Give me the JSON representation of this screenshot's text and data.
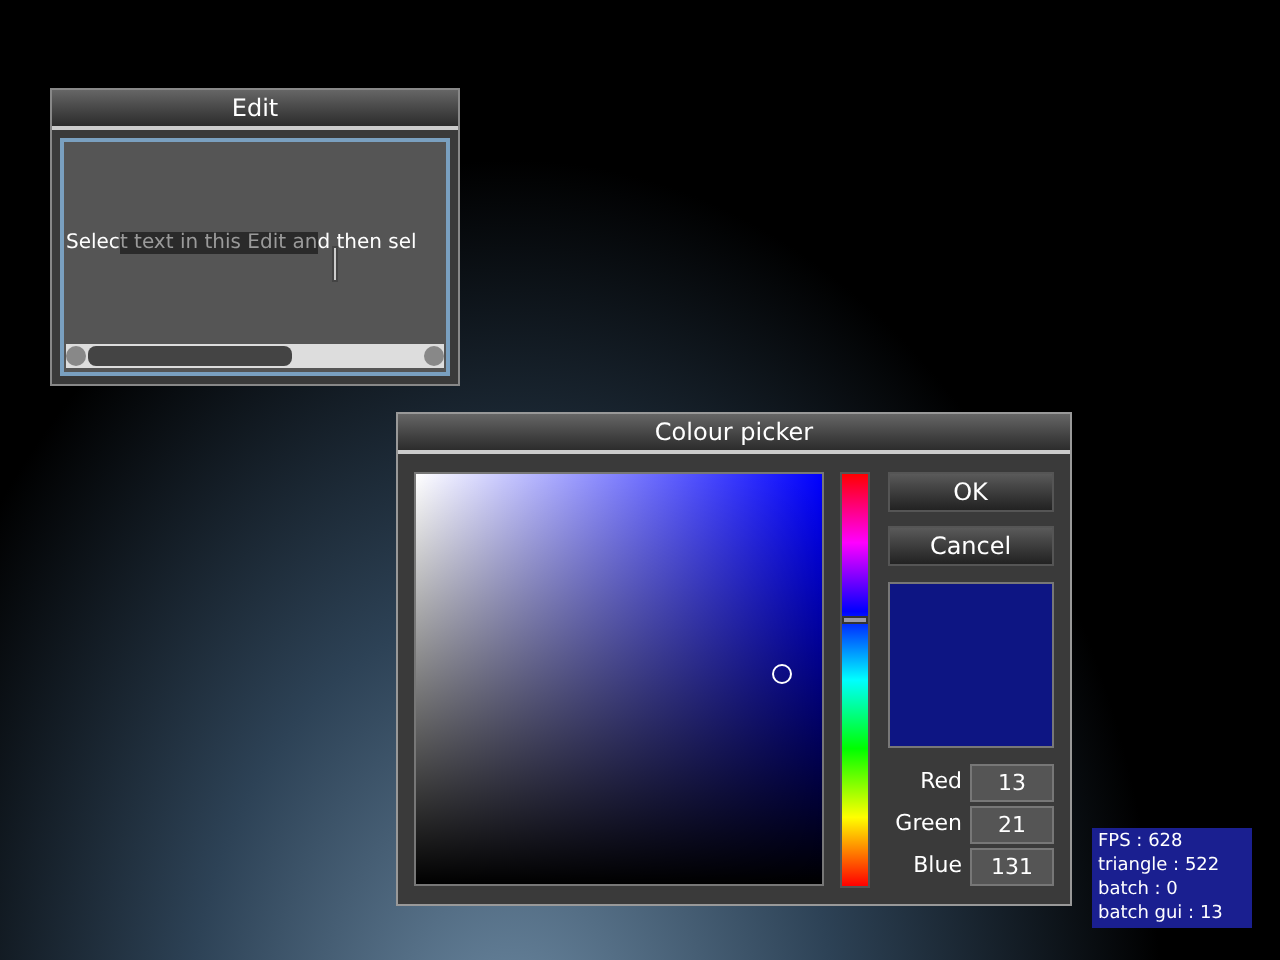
{
  "edit_window": {
    "title": "Edit",
    "text_segments": [
      {
        "text": "Selec",
        "selected": false
      },
      {
        "text": "t text in this Edit an",
        "selected": true
      },
      {
        "text": "d then sel",
        "selected": false
      }
    ]
  },
  "colour_picker": {
    "title": "Colour picker",
    "hue_slider": {
      "level": 0.65
    },
    "buttons": [
      "OK",
      "Cancel"
    ],
    "channels": [
      {
        "label": "Red",
        "value": "13"
      },
      {
        "label": "Green",
        "value": "21"
      },
      {
        "label": "Blue",
        "value": "131"
      }
    ]
  },
  "stats": [
    "FPS : 628",
    "triangle : 522",
    "batch : 0",
    "batch gui : 13"
  ]
}
